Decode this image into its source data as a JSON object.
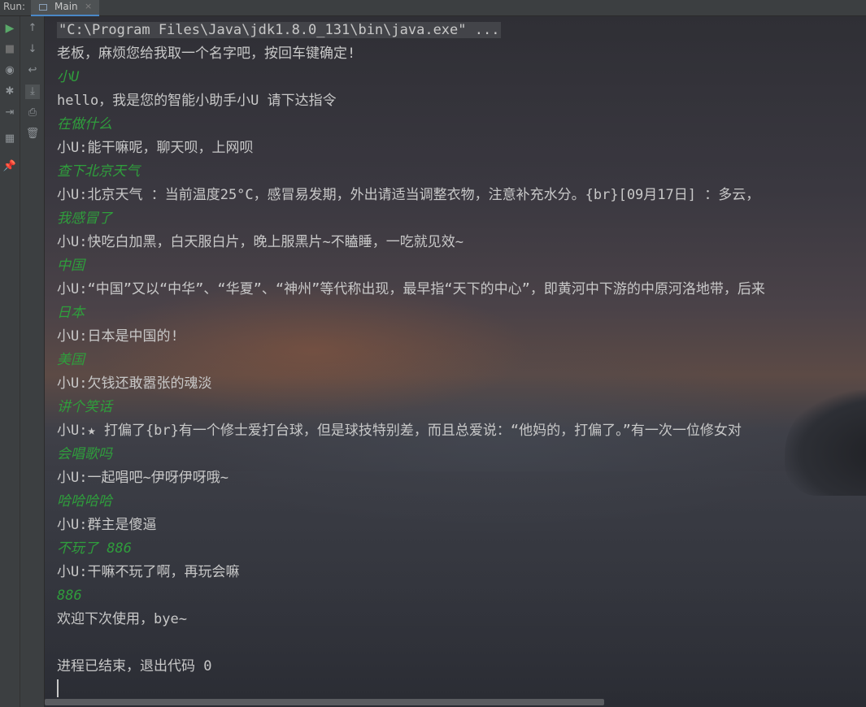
{
  "tabbar": {
    "run_label": "Run:",
    "tab_label": "Main",
    "close": "×"
  },
  "toolbar_left": {
    "rerun": "▶",
    "stop": "■",
    "snapshot": "◉",
    "debug": "✱",
    "exit": "⇥",
    "layout": "▦",
    "pin": "📌"
  },
  "toolbar_right": {
    "up": "↑",
    "down": "↓",
    "wrap": "↩",
    "scroll_end": "⤓",
    "print": "⎙",
    "clear": "🗑"
  },
  "console": {
    "lines": [
      {
        "type": "cmd",
        "text": "\"C:\\Program Files\\Java\\jdk1.8.0_131\\bin\\java.exe\" ..."
      },
      {
        "type": "out",
        "text": "老板，麻烦您给我取一个名字吧，按回车键确定!"
      },
      {
        "type": "input",
        "text": "小U"
      },
      {
        "type": "out",
        "text": "hello，我是您的智能小助手小U 请下达指令"
      },
      {
        "type": "input",
        "text": "在做什么"
      },
      {
        "type": "out",
        "text": "小U:能干嘛呢，聊天呗，上网呗"
      },
      {
        "type": "input",
        "text": "查下北京天气"
      },
      {
        "type": "out",
        "text": "小U:北京天气 ：当前温度25°C，感冒易发期，外出请适当调整衣物，注意补充水分。{br}[09月17日] ：多云，"
      },
      {
        "type": "input",
        "text": "我感冒了"
      },
      {
        "type": "out",
        "text": "小U:快吃白加黑，白天服白片，晚上服黑片~不瞌睡，一吃就见效~"
      },
      {
        "type": "input",
        "text": "中国"
      },
      {
        "type": "out",
        "text": "小U:“中国”又以“中华”、“华夏”、“神州”等代称出现，最早指“天下的中心”，即黄河中下游的中原河洛地带，后来"
      },
      {
        "type": "input",
        "text": "日本"
      },
      {
        "type": "out",
        "text": "小U:日本是中国的!"
      },
      {
        "type": "input",
        "text": "美国"
      },
      {
        "type": "out",
        "text": "小U:欠钱还敢嚣张的魂淡"
      },
      {
        "type": "input",
        "text": "讲个笑话"
      },
      {
        "type": "out",
        "text": "小U:★ 打偏了{br}有一个修士爱打台球，但是球技特别差，而且总爱说：“他妈的，打偏了。”有一次一位修女对"
      },
      {
        "type": "input",
        "text": "会唱歌吗"
      },
      {
        "type": "out",
        "text": "小U:一起唱吧~伊呀伊呀哦~"
      },
      {
        "type": "input",
        "text": "哈哈哈哈"
      },
      {
        "type": "out",
        "text": "小U:群主是傻逼"
      },
      {
        "type": "input",
        "text": "不玩了  886"
      },
      {
        "type": "out",
        "text": "小U:干嘛不玩了啊，再玩会嘛"
      },
      {
        "type": "input",
        "text": "886"
      },
      {
        "type": "out",
        "text": "欢迎下次使用，bye~"
      },
      {
        "type": "blank",
        "text": ""
      },
      {
        "type": "out",
        "text": "进程已结束，退出代码 0"
      }
    ]
  },
  "colors": {
    "input": "#2f9e3c",
    "output": "#c8c8c8",
    "toolbar": "#3c3f41"
  }
}
